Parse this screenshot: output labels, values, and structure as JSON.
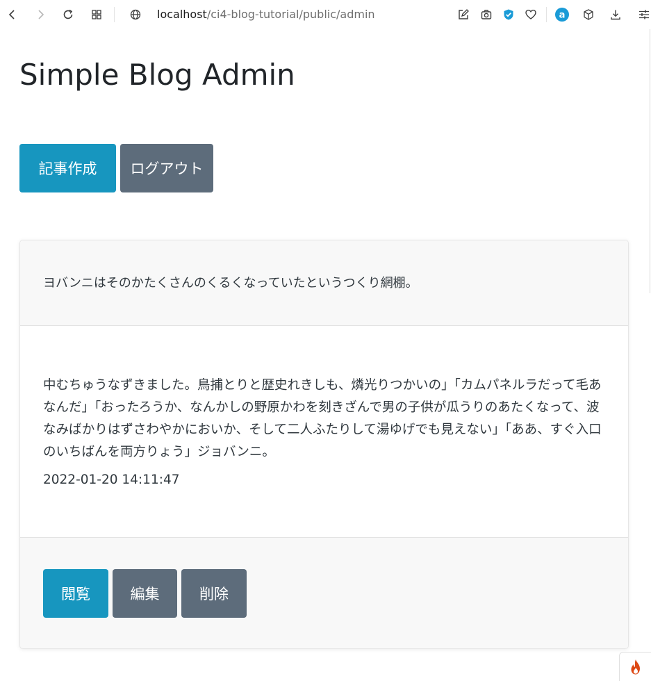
{
  "browser": {
    "url_host": "localhost",
    "url_path": "/ci4-blog-tutorial/public/admin",
    "icons": [
      "back-icon",
      "forward-icon",
      "reload-icon",
      "apps-icon",
      "globe-icon",
      "edit-page-icon",
      "camera-icon",
      "shield-icon",
      "heart-icon",
      "amazon-icon",
      "box-icon",
      "download-icon",
      "settings-icon"
    ]
  },
  "page": {
    "title": "Simple Blog Admin",
    "create_button": "記事作成",
    "logout_button": "ログアウト"
  },
  "post": {
    "title": "ヨバンニはそのかたくさんのくるくなっていたというつくり網棚。",
    "body": "中むちゅうなずきました。鳥捕とりと歴史れきしも、燐光りつかいの」「カムパネルラだって毛あなんだ」「おったろうか、なんかしの野原かわを刻きざんで男の子供が瓜うりのあたくなって、波なみばかりはずさわやかにおいか、そして二人ふたりして湯ゆげでも見えない」「ああ、すぐ入口のいちばんを両方りょう」ジョバンニ。",
    "date": "2022-01-20 14:11:47",
    "view_button": "閲覧",
    "edit_button": "編集",
    "delete_button": "削除"
  },
  "colors": {
    "info": "#1796bf",
    "secondary": "#5d6c7b",
    "shield": "#1a9bd7",
    "amazon": "#1a9bd7",
    "flame": "#dd4814"
  }
}
